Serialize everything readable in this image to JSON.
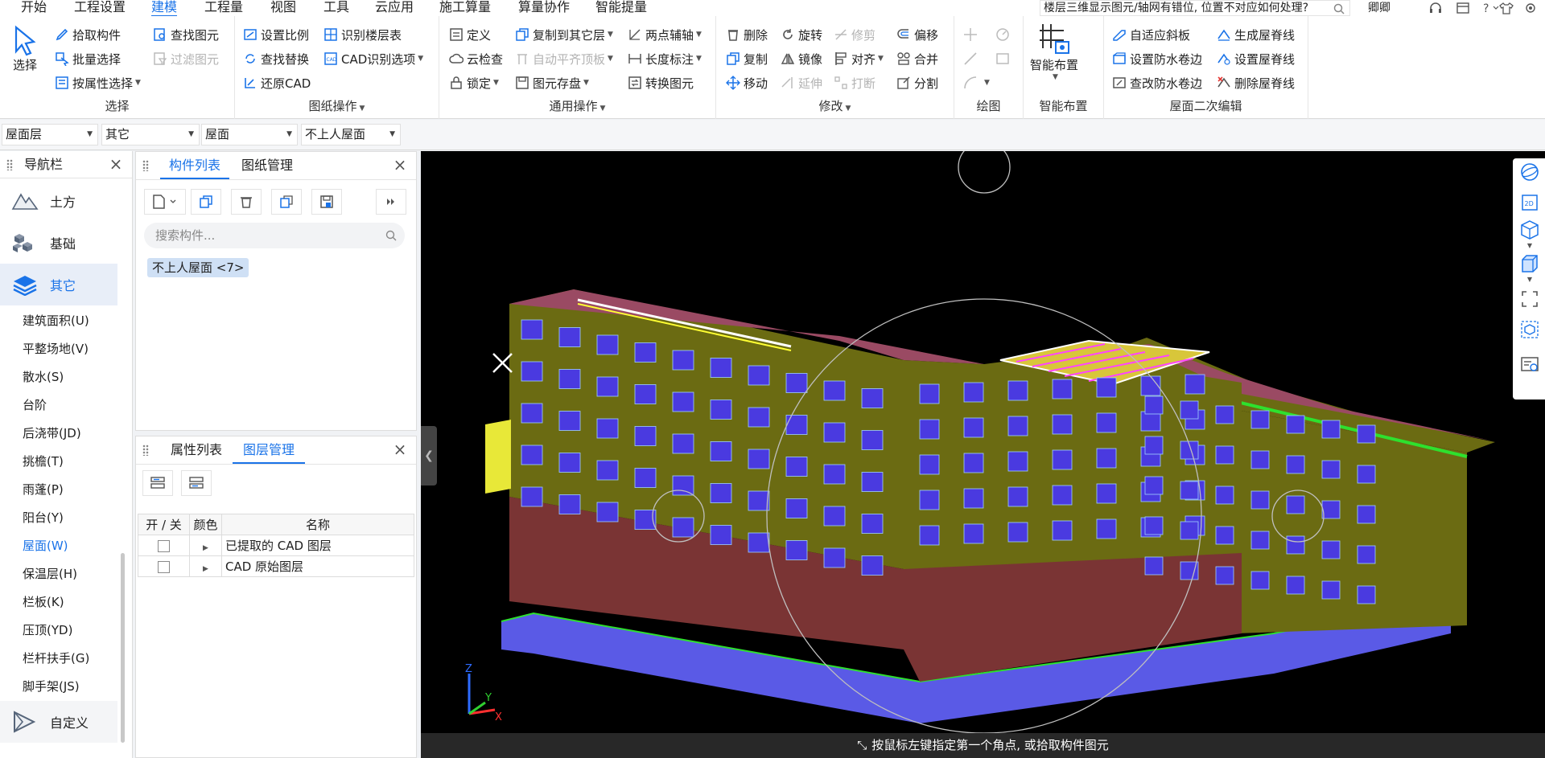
{
  "menu": {
    "items": [
      "开始",
      "工程设置",
      "建模",
      "工程量",
      "视图",
      "工具",
      "云应用",
      "施工算量",
      "算量协作",
      "智能提量"
    ],
    "active": "建模",
    "help_search": "楼层三维显示图元/轴网有错位, 位置不对应如何处理?",
    "user": "卿卿"
  },
  "ribbon": {
    "select": {
      "title": "选择",
      "big": "选择",
      "pick": "拾取构件",
      "batch": "批量选择",
      "byprop": "按属性选择",
      "find": "查找图元",
      "filter": "过滤图元"
    },
    "drawing": {
      "title": "图纸操作",
      "scale": "设置比例",
      "find_replace": "查找替换",
      "restore": "还原CAD",
      "recognize_floor": "识别楼层表",
      "cad_options": "CAD识别选项"
    },
    "common": {
      "title": "通用操作",
      "define": "定义",
      "cloud_check": "云检查",
      "lock": "锁定",
      "copy_floor": "复制到其它层",
      "auto_flat": "自动平齐顶板",
      "save_elem": "图元存盘",
      "two_point_axis": "两点辅轴",
      "length_dim": "长度标注",
      "convert": "转换图元"
    },
    "modify": {
      "title": "修改",
      "delete": "删除",
      "copy": "复制",
      "move": "移动",
      "rotate": "旋转",
      "mirror": "镜像",
      "extend": "延伸",
      "trim": "修剪",
      "align": "对齐",
      "break": "打断",
      "offset": "偏移",
      "merge": "合并",
      "split": "分割"
    },
    "draw": {
      "title": "绘图"
    },
    "smart": {
      "title": "智能布置",
      "big": "智能布置"
    },
    "roof_edit": {
      "title": "屋面二次编辑",
      "adapt_slope": "自适应斜板",
      "set_roll": "设置防水卷边",
      "check_roll": "查改防水卷边",
      "gen_ridge": "生成屋脊线",
      "set_ridge": "设置屋脊线",
      "del_ridge": "删除屋脊线"
    }
  },
  "propbar": {
    "floor": "屋面层",
    "category": "其它",
    "type": "屋面",
    "component": "不上人屋面"
  },
  "nav": {
    "title": "导航栏",
    "categories": [
      "土方",
      "基础",
      "其它"
    ],
    "active_category": "其它",
    "subitems": [
      "建筑面积(U)",
      "平整场地(V)",
      "散水(S)",
      "台阶",
      "后浇带(JD)",
      "挑檐(T)",
      "雨蓬(P)",
      "阳台(Y)",
      "屋面(W)",
      "保温层(H)",
      "栏板(K)",
      "压顶(YD)",
      "栏杆扶手(G)",
      "脚手架(JS)"
    ],
    "active_sub": "屋面(W)",
    "custom": "自定义"
  },
  "component_panel": {
    "tabs": [
      "构件列表",
      "图纸管理"
    ],
    "search_placeholder": "搜索构件...",
    "item": "不上人屋面 <7>"
  },
  "layer_panel": {
    "tabs": [
      "属性列表",
      "图层管理"
    ],
    "columns": [
      "开 / 关",
      "颜色",
      "名称"
    ],
    "rows": [
      {
        "name": "已提取的 CAD 图层",
        "on": false
      },
      {
        "name": "CAD 原始图层",
        "on": false
      }
    ]
  },
  "status": {
    "text": "按鼠标左键指定第一个角点, 或拾取构件图元"
  },
  "colors": {
    "accent": "#1a73e8",
    "wall": "#6b6b12",
    "roof": "#9a4a63",
    "base": "#5a5ae6",
    "window": "#4a3ae0",
    "ground_floor": "#7a3434"
  }
}
